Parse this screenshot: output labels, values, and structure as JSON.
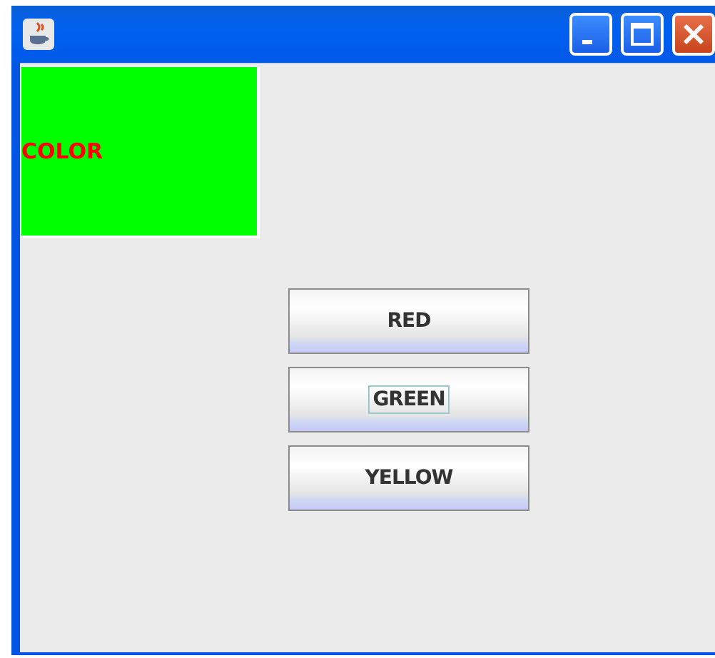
{
  "panel": {
    "label": "COLOR",
    "color": "#00ff00"
  },
  "buttons": [
    {
      "label": "RED",
      "focused": false
    },
    {
      "label": "GREEN",
      "focused": true
    },
    {
      "label": "YELLOW",
      "focused": false
    }
  ]
}
